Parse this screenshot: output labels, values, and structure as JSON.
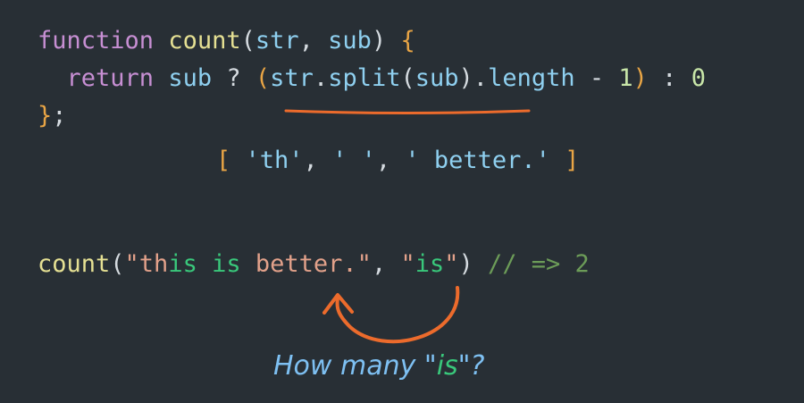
{
  "code": {
    "line1": {
      "kw_function": "function",
      "sp1": " ",
      "fn_name": "count",
      "paren_open": "(",
      "arg1": "str",
      "comma": ", ",
      "arg2": "sub",
      "paren_close": ")",
      "sp2": " ",
      "brace_open": "{"
    },
    "line2": {
      "indent": "  ",
      "kw_return": "return",
      "sp1": " ",
      "sub": "sub",
      "ternary_q": " ? ",
      "paren_open": "(",
      "str": "str",
      "dot1": ".",
      "split": "split",
      "split_paren_open": "(",
      "split_arg": "sub",
      "split_paren_close": ")",
      "dot2": ".",
      "length": "length",
      "minus": " - ",
      "one": "1",
      "paren_close": ")",
      "ternary_colon": " : ",
      "zero": "0"
    },
    "line3": {
      "brace_close": "}",
      "semicolon": ";"
    }
  },
  "split_result": {
    "bracket_open": "[ ",
    "item1": "'th'",
    "sep1": ", ",
    "item2": "' '",
    "sep2": ", ",
    "item3": "' better.'",
    "bracket_close": " ]"
  },
  "call_line": {
    "fn": "count",
    "paren_open": "(",
    "str_quote_open": "\"th",
    "str_is1": "is",
    "str_space1": " ",
    "str_is2": "is",
    "str_rest": " better.\"",
    "comma": ", ",
    "sub_quote_open": "\"",
    "sub_is": "is",
    "sub_quote_close": "\"",
    "paren_close": ")",
    "comment": " // => 2"
  },
  "annotation": {
    "prefix": "How many \"",
    "highlight": "is",
    "suffix": "\"?"
  },
  "colors": {
    "background": "#282f35",
    "keyword": "#c78fd3",
    "function": "#e5e093",
    "variable": "#8fd0f0",
    "brace": "#e9a545",
    "string": "#e2a18a",
    "highlight": "#39c87b",
    "comment": "#6c9c58",
    "annotation_ink": "#7ec0f2",
    "marker": "#ec6b2c"
  }
}
